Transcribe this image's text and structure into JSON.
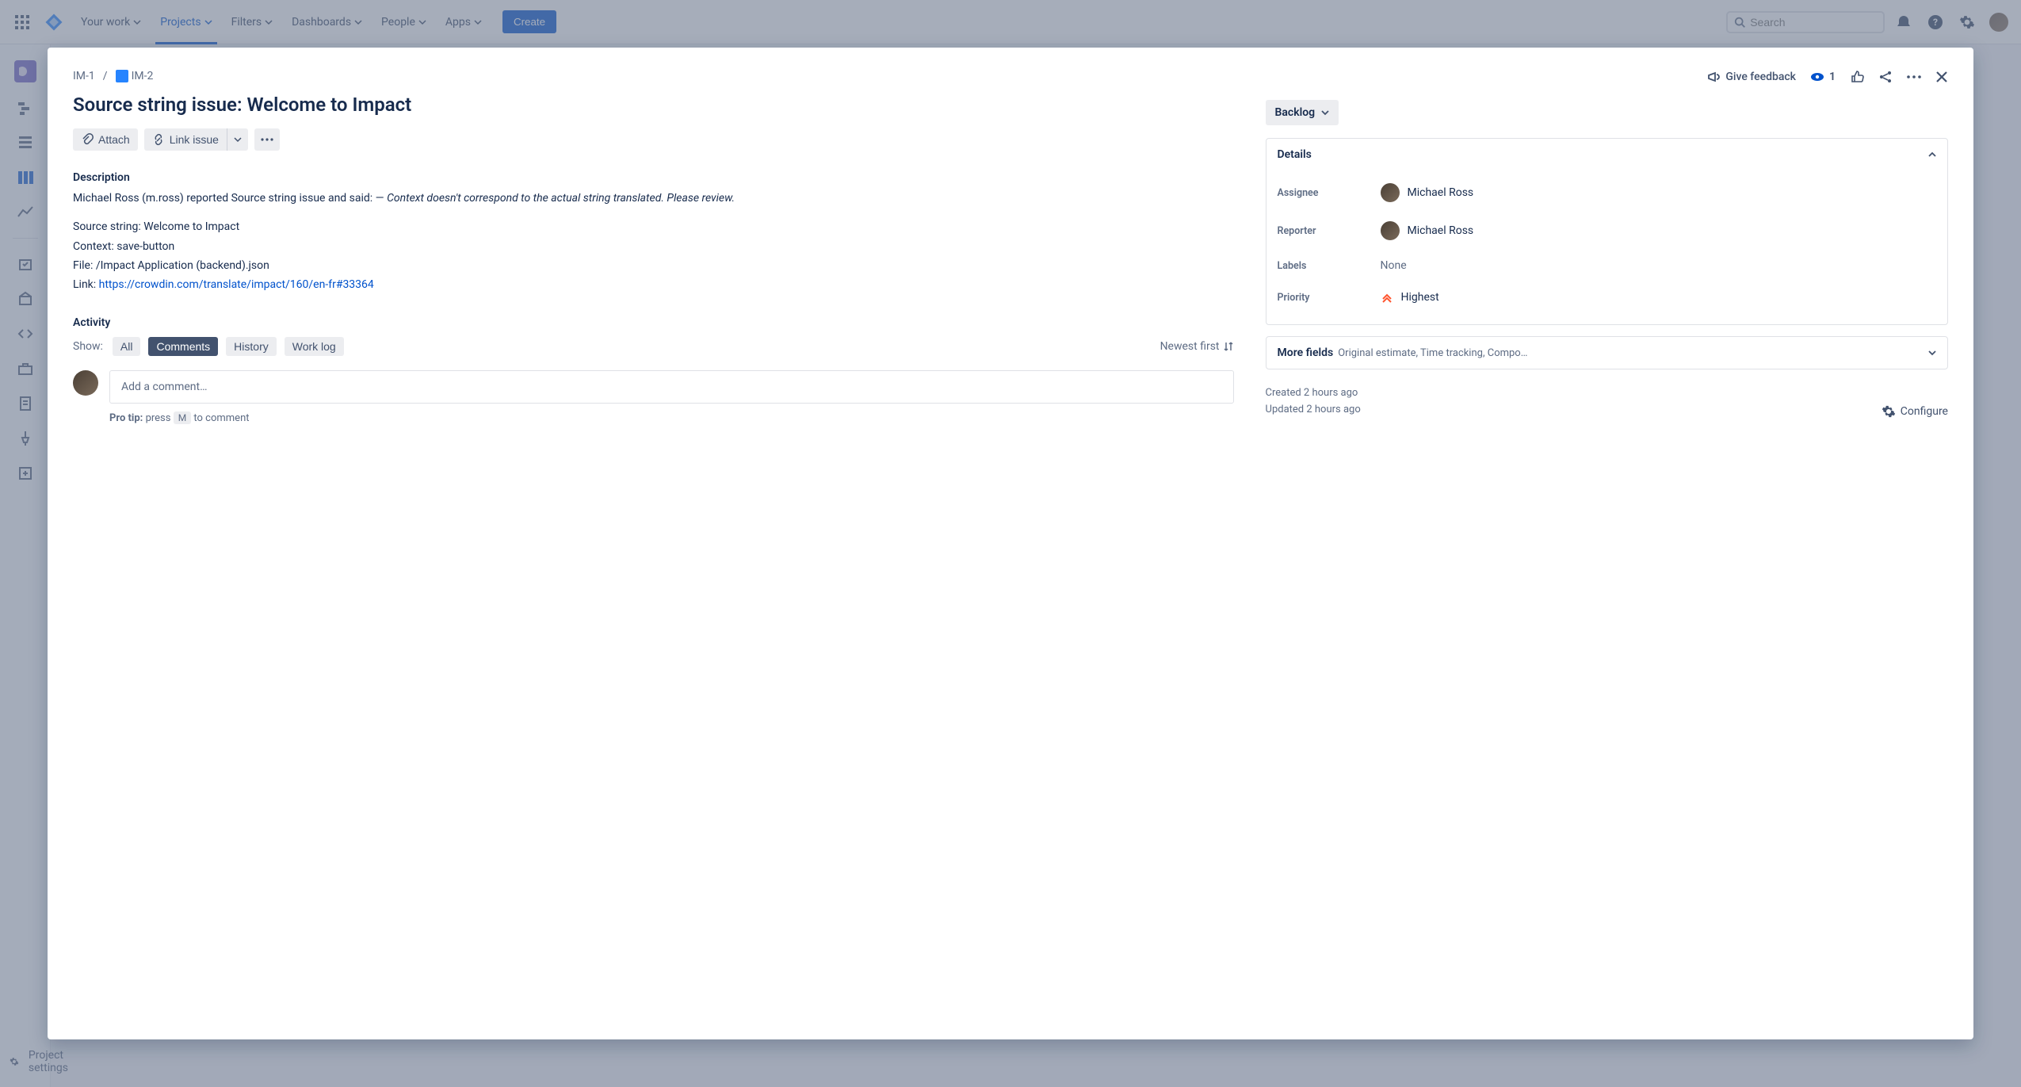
{
  "topnav": {
    "items": [
      "Your work",
      "Projects",
      "Filters",
      "Dashboards",
      "People",
      "Apps"
    ],
    "active_index": 1,
    "create": "Create",
    "search_placeholder": "Search"
  },
  "sidebar": {
    "project_settings": "Project settings"
  },
  "modal": {
    "breadcrumb": {
      "parent": "IM-1",
      "child": "IM-2"
    },
    "title": "Source string issue: Welcome to Impact",
    "actions": {
      "attach": "Attach",
      "link_issue": "Link issue"
    },
    "description": {
      "heading": "Description",
      "lead": "Michael Ross (m.ross) reported Source string issue and said: — ",
      "quote": "Context doesn't correspond to the actual string translated. Please review.",
      "lines": {
        "source": "Source string: Welcome to Impact",
        "context": "Context: save-button",
        "file": "File: /Impact Application (backend).json",
        "link_label": "Link: ",
        "link_url": "https://crowdin.com/translate/impact/160/en-fr#33364"
      }
    },
    "activity": {
      "heading": "Activity",
      "show_label": "Show:",
      "tabs": [
        "All",
        "Comments",
        "History",
        "Work log"
      ],
      "selected_tab": 1,
      "sort": "Newest first",
      "comment_placeholder": "Add a comment…",
      "protip_pre": "Pro tip: ",
      "protip_mid": "press ",
      "protip_key": "M",
      "protip_post": " to comment"
    },
    "side": {
      "give_feedback": "Give feedback",
      "watch_count": "1",
      "status": "Backlog",
      "details_heading": "Details",
      "fields": {
        "assignee_label": "Assignee",
        "assignee": "Michael Ross",
        "reporter_label": "Reporter",
        "reporter": "Michael Ross",
        "labels_label": "Labels",
        "labels": "None",
        "priority_label": "Priority",
        "priority": "Highest"
      },
      "more_fields": "More fields",
      "more_fields_desc": "Original estimate, Time tracking, Compone…",
      "created": "Created 2 hours ago",
      "updated": "Updated 2 hours ago",
      "configure": "Configure"
    }
  }
}
